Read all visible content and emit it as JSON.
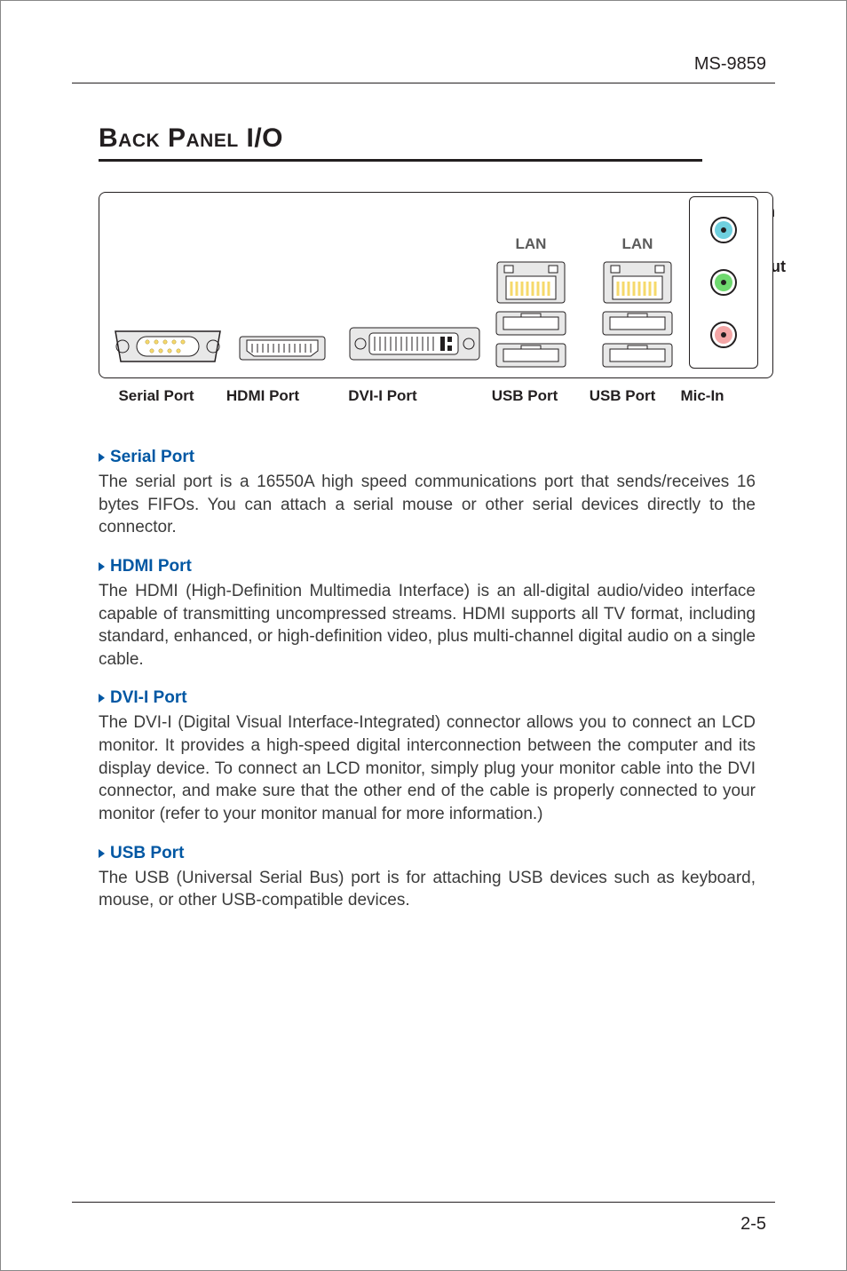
{
  "model": "MS-9859",
  "section_title": "Back Panel I/O",
  "diagram": {
    "lan_label": "LAN",
    "audio": {
      "line_in": "Line-In",
      "line_out": "Line-Out"
    },
    "icons": {
      "serial": "serial-port-icon",
      "hdmi": "hdmi-port-icon",
      "dvi": "dvi-i-port-icon",
      "rj45": "rj45-lan-icon",
      "usb": "usb-port-icon",
      "jack_blue": "audio-jack-blue-icon",
      "jack_green": "audio-jack-green-icon",
      "jack_pink": "audio-jack-pink-icon"
    }
  },
  "labels": {
    "serial": "Serial Port",
    "hdmi": "HDMI Port",
    "dvi": "DVI-I Port",
    "usb": "USB Port",
    "mic": "Mic-In"
  },
  "sections": [
    {
      "heading": "Serial Port",
      "text": "The serial port is a 16550A high speed communications port that sends/receives 16 bytes FIFOs. You can attach a serial mouse or other serial devices directly to the connector."
    },
    {
      "heading": "HDMI Port",
      "text": "The HDMI (High-Definition Multimedia Interface) is an all-digital audio/video interface capable of transmitting uncompressed streams. HDMI supports all TV format, including standard, enhanced, or high-definition video, plus multi-channel digital audio on a single cable."
    },
    {
      "heading": "DVI-I Port",
      "text": "The DVI-I (Digital Visual Interface-Integrated) connector allows you to connect an LCD monitor. It provides a high-speed digital interconnection between the computer and its display device. To connect an LCD monitor, simply plug your monitor cable into the DVI connector, and make sure that the other end of the cable is properly connected to your monitor (refer to your monitor manual for more information.)"
    },
    {
      "heading": "USB Port",
      "text": "The USB (Universal Serial Bus) port is for attaching USB devices such as keyboard, mouse, or other USB-compatible devices."
    }
  ],
  "page_number": "2-5"
}
